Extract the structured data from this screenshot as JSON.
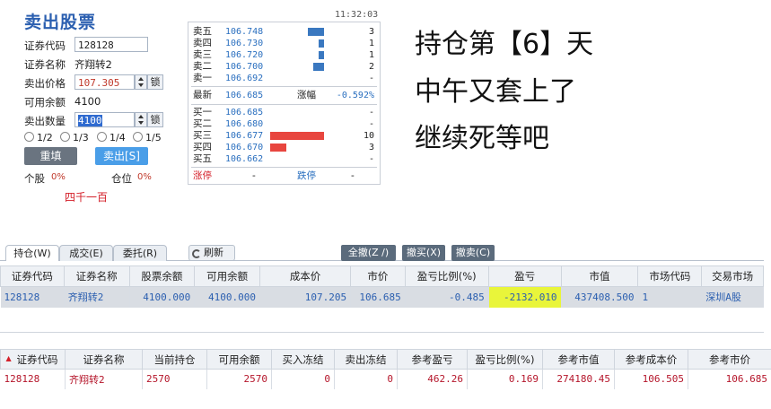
{
  "panel": {
    "title": "卖出股票",
    "time": "11:32:03",
    "code_label": "证券代码",
    "code_value": "128128",
    "name_label": "证券名称",
    "name_value": "齐翔转2",
    "price_label": "卖出价格",
    "price_value": "107.305",
    "lock_label": "锁",
    "avail_label": "可用余额",
    "avail_value": "4100",
    "qty_label": "卖出数量",
    "qty_value": "4100",
    "fractions": [
      "1/2",
      "1/3",
      "1/4",
      "1/5"
    ],
    "reset_label": "重填",
    "sell_label": "卖出[S]",
    "stock_pos_label": "个股",
    "stock_pos_value": "0%",
    "position_label": "仓位",
    "position_value": "0%",
    "note": "四千一百"
  },
  "quote": {
    "asks": [
      {
        "name": "卖五",
        "price": "106.748",
        "vol": "3",
        "bar": 3
      },
      {
        "name": "卖四",
        "price": "106.730",
        "vol": "1",
        "bar": 1
      },
      {
        "name": "卖三",
        "price": "106.720",
        "vol": "1",
        "bar": 1
      },
      {
        "name": "卖二",
        "price": "106.700",
        "vol": "2",
        "bar": 2
      },
      {
        "name": "卖一",
        "price": "106.692",
        "vol": "-",
        "bar": 0
      }
    ],
    "last_label": "最新",
    "last_price": "106.685",
    "change_label": "涨幅",
    "change_value": "-0.592%",
    "bids": [
      {
        "name": "买一",
        "price": "106.685",
        "vol": "-",
        "bar": 0
      },
      {
        "name": "买二",
        "price": "106.680",
        "vol": "-",
        "bar": 0
      },
      {
        "name": "买三",
        "price": "106.677",
        "vol": "10",
        "bar": 10
      },
      {
        "name": "买四",
        "price": "106.670",
        "vol": "3",
        "bar": 3
      },
      {
        "name": "买五",
        "price": "106.662",
        "vol": "-",
        "bar": 0
      }
    ],
    "limit_up_label": "涨停",
    "limit_up_value": "-",
    "limit_down_label": "跌停",
    "limit_down_value": "-",
    "ask_color": "#3a78c0",
    "bid_color": "#e8463f"
  },
  "overlay": {
    "line1": "持仓第【6】天",
    "line2": "中午又套上了",
    "line3": "继续死等吧"
  },
  "tabs": [
    "持仓(W)",
    "成交(E)",
    "委托(R)"
  ],
  "refresh_label": "刷新",
  "actions": [
    "全撤(Z /)",
    "撤买(X)",
    "撤卖(C)"
  ],
  "holdings": {
    "headers": [
      "证券代码",
      "证券名称",
      "股票余额",
      "可用余额",
      "成本价",
      "市价",
      "盈亏比例(%)",
      "盈亏",
      "市值",
      "市场代码",
      "交易市场"
    ],
    "rows": [
      [
        "128128",
        "齐翔转2",
        "4100.000",
        "4100.000",
        "107.205",
        "106.685",
        "-0.485",
        "-2132.010",
        "437408.500",
        "1",
        "深圳A股"
      ]
    ]
  },
  "ref_table": {
    "headers": [
      "证券代码",
      "证券名称",
      "当前持仓",
      "可用余额",
      "买入冻结",
      "卖出冻结",
      "参考盈亏",
      "盈亏比例(%)",
      "参考市值",
      "参考成本价",
      "参考市价"
    ],
    "rows": [
      [
        "128128",
        "齐翔转2",
        "2570",
        "2570",
        "0",
        "0",
        "462.26",
        "0.169",
        "274180.45",
        "106.505",
        "106.685"
      ]
    ]
  }
}
